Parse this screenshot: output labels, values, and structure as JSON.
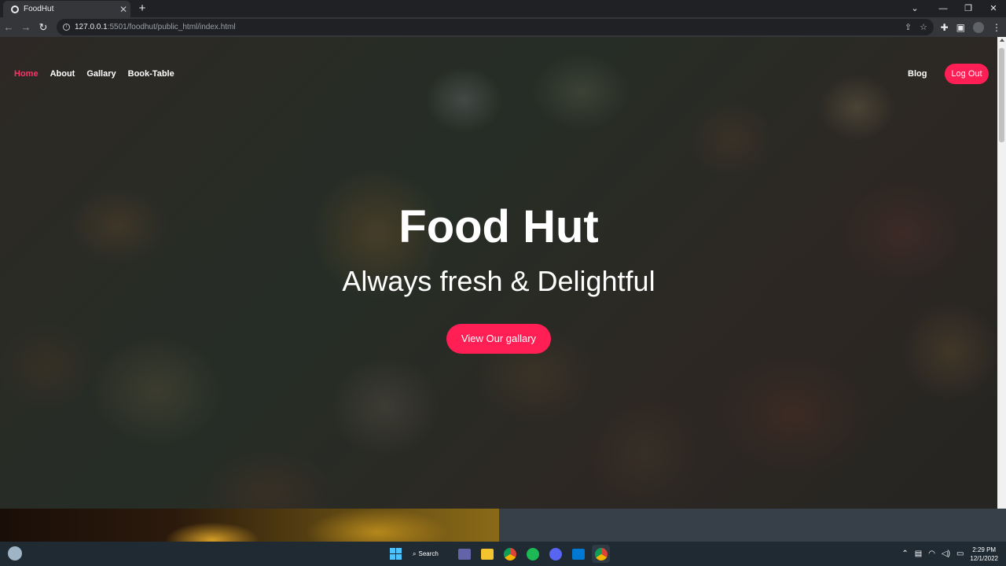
{
  "browser": {
    "tab_title": "FoodHut",
    "tab_close": "✕",
    "new_tab": "+",
    "url_host": "127.0.0.1",
    "url_rest": ":5501/foodhut/public_html/index.html",
    "window_controls": [
      "⌄",
      "—",
      "❐",
      "✕"
    ]
  },
  "nav": {
    "links": [
      "Home",
      "About",
      "Gallary",
      "Book-Table"
    ],
    "blog": "Blog",
    "logout": "Log Out"
  },
  "hero": {
    "title": "Food Hut",
    "subtitle": "Always fresh & Delightful",
    "cta": "View Our gallary"
  },
  "taskbar": {
    "search_label": "Search",
    "time": "2:29 PM",
    "date": "12/1/2022"
  },
  "colors": {
    "accent": "#ff1f55",
    "active_link": "#ff3366"
  }
}
